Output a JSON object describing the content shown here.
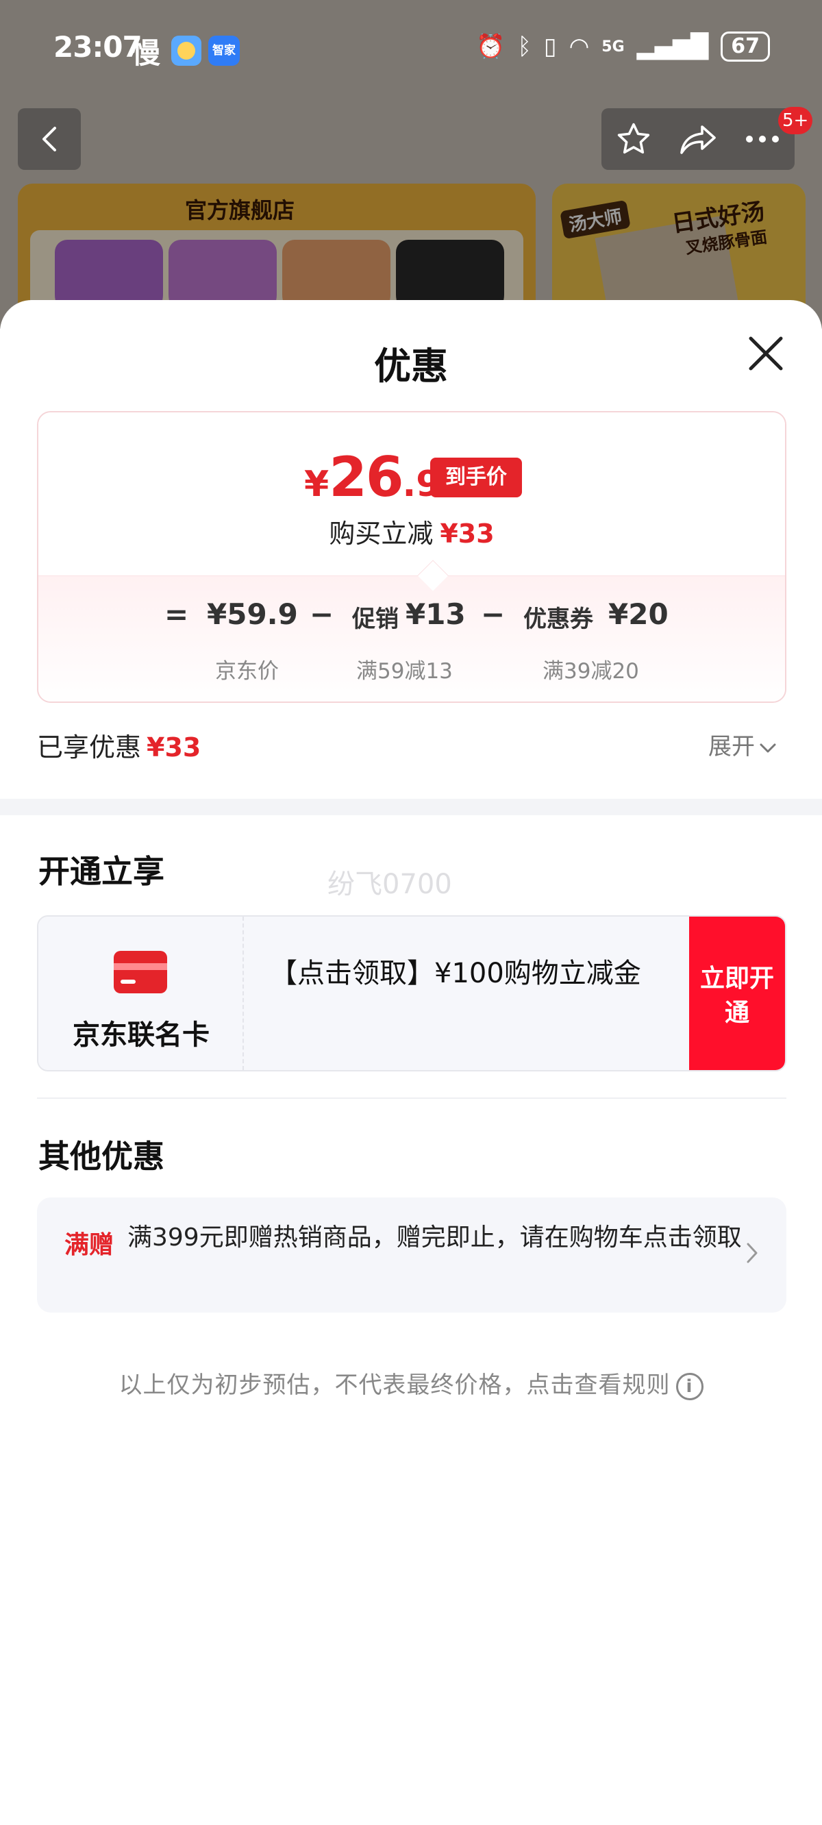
{
  "status_bar": {
    "time": "23:07",
    "slow_label": "慢",
    "app_badge": "智家",
    "battery": "67",
    "network": "5G"
  },
  "background": {
    "store_banner_title": "官方旗舰店",
    "banner2_title": "日式好汤",
    "banner2_subtitle": "叉烧豚骨面",
    "banner2_tag": "汤大师",
    "more_badge": "5+"
  },
  "sheet": {
    "title": "优惠",
    "price": {
      "currency": "¥",
      "integer": "26",
      "decimal": ".9",
      "tag": "到手价",
      "reduce_label": "购买立减",
      "reduce_amount": "¥33"
    },
    "breakdown": {
      "equals": "=",
      "jd_price": "¥59.9",
      "minus1": "−",
      "promo_label": "促销",
      "promo_amount": "¥13",
      "minus2": "−",
      "coupon_label": "优惠券",
      "coupon_amount": "¥20",
      "jd_price_caption": "京东价",
      "promo_caption": "满59减13",
      "coupon_caption": "满39减20"
    },
    "enjoyed_label": "已享优惠",
    "enjoyed_amount": "¥33",
    "expand_label": "展开",
    "open_section": {
      "title": "开通立享",
      "watermark": "纷飞0700",
      "card_name": "京东联名卡",
      "card_desc": "【点击领取】¥100购物立减金",
      "card_button": "立即开通"
    },
    "other_section": {
      "title": "其他优惠",
      "promo_tag": "满赠",
      "promo_text": "满399元即赠热销商品，赠完即止，请在购物车点击领取"
    },
    "footnote": "以上仅为初步预估，不代表最终价格，点击查看规则"
  }
}
